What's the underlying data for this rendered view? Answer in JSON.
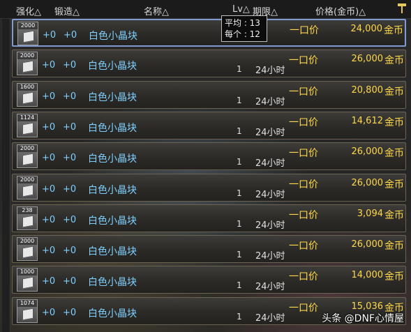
{
  "header": {
    "enhance": "强化△",
    "forge": "锻造△",
    "name": "名称△",
    "level": "Lv△",
    "duration": "期限△",
    "price": "价格(金币)△"
  },
  "tooltip": {
    "line1": "平均 : 13",
    "line2": "每个 : 12"
  },
  "rows": [
    {
      "qty": "2000",
      "enhance": "+0",
      "forge": "+0",
      "name": "白色小晶块",
      "level": "",
      "duration": "",
      "type": "一口价",
      "price": "24,000",
      "currency": "金币"
    },
    {
      "qty": "2000",
      "enhance": "+0",
      "forge": "+0",
      "name": "白色小晶块",
      "level": "1",
      "duration": "24小时",
      "type": "一口价",
      "price": "26,000",
      "currency": "金币"
    },
    {
      "qty": "1600",
      "enhance": "+0",
      "forge": "+0",
      "name": "白色小晶块",
      "level": "1",
      "duration": "24小时",
      "type": "一口价",
      "price": "20,800",
      "currency": "金币"
    },
    {
      "qty": "1124",
      "enhance": "+0",
      "forge": "+0",
      "name": "白色小晶块",
      "level": "1",
      "duration": "24小时",
      "type": "一口价",
      "price": "14,612",
      "currency": "金币"
    },
    {
      "qty": "2000",
      "enhance": "+0",
      "forge": "+0",
      "name": "白色小晶块",
      "level": "1",
      "duration": "24小时",
      "type": "一口价",
      "price": "26,000",
      "currency": "金币"
    },
    {
      "qty": "2000",
      "enhance": "+0",
      "forge": "+0",
      "name": "白色小晶块",
      "level": "1",
      "duration": "24小时",
      "type": "一口价",
      "price": "26,000",
      "currency": "金币"
    },
    {
      "qty": "238",
      "enhance": "+0",
      "forge": "+0",
      "name": "白色小晶块",
      "level": "1",
      "duration": "24小时",
      "type": "一口价",
      "price": "3,094",
      "currency": "金币"
    },
    {
      "qty": "2000",
      "enhance": "+0",
      "forge": "+0",
      "name": "白色小晶块",
      "level": "1",
      "duration": "24小时",
      "type": "一口价",
      "price": "26,000",
      "currency": "金币"
    },
    {
      "qty": "1000",
      "enhance": "+0",
      "forge": "+0",
      "name": "白色小晶块",
      "level": "1",
      "duration": "24小时",
      "type": "一口价",
      "price": "14,000",
      "currency": "金币"
    },
    {
      "qty": "1074",
      "enhance": "+0",
      "forge": "+0",
      "name": "白色小晶块",
      "level": "1",
      "duration": "24小时",
      "type": "一口价",
      "price": "15,036",
      "currency": "金币"
    }
  ],
  "watermark": "头条 @DNF心情屋",
  "hammer_icon": "hammer-icon",
  "colors": {
    "accent": "#7fd0ff",
    "price": "#ffd84a",
    "selected_border": "#7f9bd0"
  }
}
